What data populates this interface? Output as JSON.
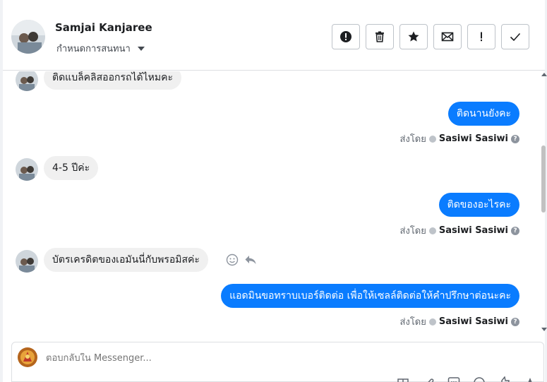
{
  "header": {
    "contact_name": "Samjai Kanjaree",
    "assign_label": "กำหนดการสนทนา"
  },
  "toolbar": {
    "buttons": [
      {
        "icon": "alert-circle-icon"
      },
      {
        "icon": "trash-icon"
      },
      {
        "icon": "star-icon"
      },
      {
        "icon": "envelope-icon"
      },
      {
        "icon": "exclamation-icon"
      },
      {
        "icon": "checkmark-icon"
      }
    ]
  },
  "messages": [
    {
      "direction": "in",
      "text": "ติดแบล็คลิสออกรถได้ไหมคะ"
    },
    {
      "direction": "out",
      "text": "ติดนานยังคะ",
      "sent_prefix": "ส่งโดย",
      "sender": "Sasiwi Sasiwi"
    },
    {
      "direction": "in",
      "text": "4-5 ปีค่ะ"
    },
    {
      "direction": "out",
      "text": "ติดของอะไรคะ",
      "sent_prefix": "ส่งโดย",
      "sender": "Sasiwi Sasiwi"
    },
    {
      "direction": "in",
      "text": "บัตรเครดิตของเอมันนี่กับพรอมิสค่ะ"
    },
    {
      "direction": "out",
      "text": "แอดมินขอทราบเบอร์ติดต่อ เพื่อให้เซลล์ติดต่อให้คำปรึกษาต่อนะคะ",
      "sent_prefix": "ส่งโดย",
      "sender": "Sasiwi Sasiwi"
    }
  ],
  "composer": {
    "placeholder": "ตอบกลับใน Messenger..."
  },
  "colors": {
    "outgoing_bubble": "#0a7cff",
    "incoming_bubble": "#f0f0f0"
  }
}
